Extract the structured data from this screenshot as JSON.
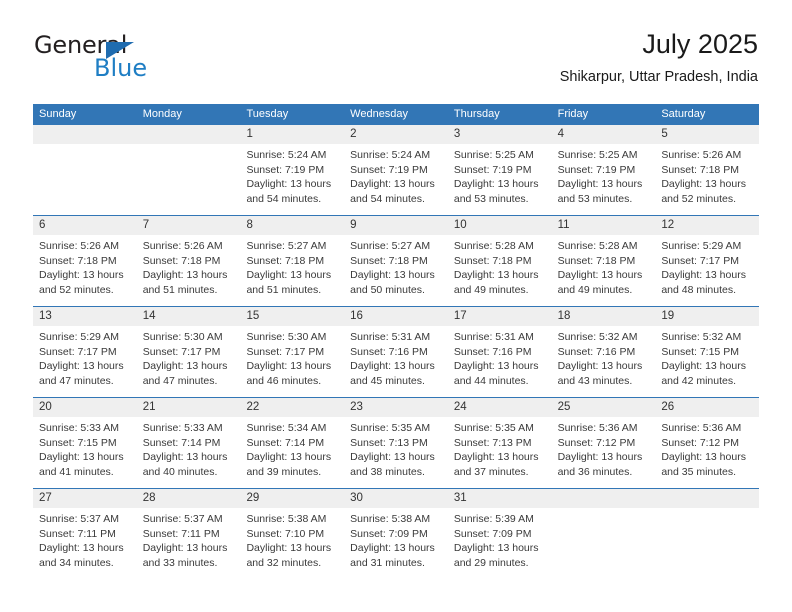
{
  "brand": {
    "name_part1": "General",
    "name_part2": "Blue",
    "triangle_icon": "triangle-icon",
    "colors": {
      "dark": "#231f20",
      "blue": "#1f7ec4",
      "triangle": "#1f6cb0"
    }
  },
  "header": {
    "title": "July 2025",
    "subtitle": "Shikarpur, Uttar Pradesh, India"
  },
  "calendar": {
    "accent_color": "#3276b6",
    "date_strip_color": "#efefef",
    "weekdays": [
      "Sunday",
      "Monday",
      "Tuesday",
      "Wednesday",
      "Thursday",
      "Friday",
      "Saturday"
    ],
    "weeks": [
      {
        "dates": [
          "",
          "",
          "1",
          "2",
          "3",
          "4",
          "5"
        ],
        "cells": [
          {
            "lines": []
          },
          {
            "lines": []
          },
          {
            "lines": [
              "Sunrise: 5:24 AM",
              "Sunset: 7:19 PM",
              "Daylight: 13 hours",
              "and 54 minutes."
            ]
          },
          {
            "lines": [
              "Sunrise: 5:24 AM",
              "Sunset: 7:19 PM",
              "Daylight: 13 hours",
              "and 54 minutes."
            ]
          },
          {
            "lines": [
              "Sunrise: 5:25 AM",
              "Sunset: 7:19 PM",
              "Daylight: 13 hours",
              "and 53 minutes."
            ]
          },
          {
            "lines": [
              "Sunrise: 5:25 AM",
              "Sunset: 7:19 PM",
              "Daylight: 13 hours",
              "and 53 minutes."
            ]
          },
          {
            "lines": [
              "Sunrise: 5:26 AM",
              "Sunset: 7:18 PM",
              "Daylight: 13 hours",
              "and 52 minutes."
            ]
          }
        ]
      },
      {
        "dates": [
          "6",
          "7",
          "8",
          "9",
          "10",
          "11",
          "12"
        ],
        "cells": [
          {
            "lines": [
              "Sunrise: 5:26 AM",
              "Sunset: 7:18 PM",
              "Daylight: 13 hours",
              "and 52 minutes."
            ]
          },
          {
            "lines": [
              "Sunrise: 5:26 AM",
              "Sunset: 7:18 PM",
              "Daylight: 13 hours",
              "and 51 minutes."
            ]
          },
          {
            "lines": [
              "Sunrise: 5:27 AM",
              "Sunset: 7:18 PM",
              "Daylight: 13 hours",
              "and 51 minutes."
            ]
          },
          {
            "lines": [
              "Sunrise: 5:27 AM",
              "Sunset: 7:18 PM",
              "Daylight: 13 hours",
              "and 50 minutes."
            ]
          },
          {
            "lines": [
              "Sunrise: 5:28 AM",
              "Sunset: 7:18 PM",
              "Daylight: 13 hours",
              "and 49 minutes."
            ]
          },
          {
            "lines": [
              "Sunrise: 5:28 AM",
              "Sunset: 7:18 PM",
              "Daylight: 13 hours",
              "and 49 minutes."
            ]
          },
          {
            "lines": [
              "Sunrise: 5:29 AM",
              "Sunset: 7:17 PM",
              "Daylight: 13 hours",
              "and 48 minutes."
            ]
          }
        ]
      },
      {
        "dates": [
          "13",
          "14",
          "15",
          "16",
          "17",
          "18",
          "19"
        ],
        "cells": [
          {
            "lines": [
              "Sunrise: 5:29 AM",
              "Sunset: 7:17 PM",
              "Daylight: 13 hours",
              "and 47 minutes."
            ]
          },
          {
            "lines": [
              "Sunrise: 5:30 AM",
              "Sunset: 7:17 PM",
              "Daylight: 13 hours",
              "and 47 minutes."
            ]
          },
          {
            "lines": [
              "Sunrise: 5:30 AM",
              "Sunset: 7:17 PM",
              "Daylight: 13 hours",
              "and 46 minutes."
            ]
          },
          {
            "lines": [
              "Sunrise: 5:31 AM",
              "Sunset: 7:16 PM",
              "Daylight: 13 hours",
              "and 45 minutes."
            ]
          },
          {
            "lines": [
              "Sunrise: 5:31 AM",
              "Sunset: 7:16 PM",
              "Daylight: 13 hours",
              "and 44 minutes."
            ]
          },
          {
            "lines": [
              "Sunrise: 5:32 AM",
              "Sunset: 7:16 PM",
              "Daylight: 13 hours",
              "and 43 minutes."
            ]
          },
          {
            "lines": [
              "Sunrise: 5:32 AM",
              "Sunset: 7:15 PM",
              "Daylight: 13 hours",
              "and 42 minutes."
            ]
          }
        ]
      },
      {
        "dates": [
          "20",
          "21",
          "22",
          "23",
          "24",
          "25",
          "26"
        ],
        "cells": [
          {
            "lines": [
              "Sunrise: 5:33 AM",
              "Sunset: 7:15 PM",
              "Daylight: 13 hours",
              "and 41 minutes."
            ]
          },
          {
            "lines": [
              "Sunrise: 5:33 AM",
              "Sunset: 7:14 PM",
              "Daylight: 13 hours",
              "and 40 minutes."
            ]
          },
          {
            "lines": [
              "Sunrise: 5:34 AM",
              "Sunset: 7:14 PM",
              "Daylight: 13 hours",
              "and 39 minutes."
            ]
          },
          {
            "lines": [
              "Sunrise: 5:35 AM",
              "Sunset: 7:13 PM",
              "Daylight: 13 hours",
              "and 38 minutes."
            ]
          },
          {
            "lines": [
              "Sunrise: 5:35 AM",
              "Sunset: 7:13 PM",
              "Daylight: 13 hours",
              "and 37 minutes."
            ]
          },
          {
            "lines": [
              "Sunrise: 5:36 AM",
              "Sunset: 7:12 PM",
              "Daylight: 13 hours",
              "and 36 minutes."
            ]
          },
          {
            "lines": [
              "Sunrise: 5:36 AM",
              "Sunset: 7:12 PM",
              "Daylight: 13 hours",
              "and 35 minutes."
            ]
          }
        ]
      },
      {
        "dates": [
          "27",
          "28",
          "29",
          "30",
          "31",
          "",
          ""
        ],
        "cells": [
          {
            "lines": [
              "Sunrise: 5:37 AM",
              "Sunset: 7:11 PM",
              "Daylight: 13 hours",
              "and 34 minutes."
            ]
          },
          {
            "lines": [
              "Sunrise: 5:37 AM",
              "Sunset: 7:11 PM",
              "Daylight: 13 hours",
              "and 33 minutes."
            ]
          },
          {
            "lines": [
              "Sunrise: 5:38 AM",
              "Sunset: 7:10 PM",
              "Daylight: 13 hours",
              "and 32 minutes."
            ]
          },
          {
            "lines": [
              "Sunrise: 5:38 AM",
              "Sunset: 7:09 PM",
              "Daylight: 13 hours",
              "and 31 minutes."
            ]
          },
          {
            "lines": [
              "Sunrise: 5:39 AM",
              "Sunset: 7:09 PM",
              "Daylight: 13 hours",
              "and 29 minutes."
            ]
          },
          {
            "lines": []
          },
          {
            "lines": []
          }
        ]
      }
    ]
  }
}
